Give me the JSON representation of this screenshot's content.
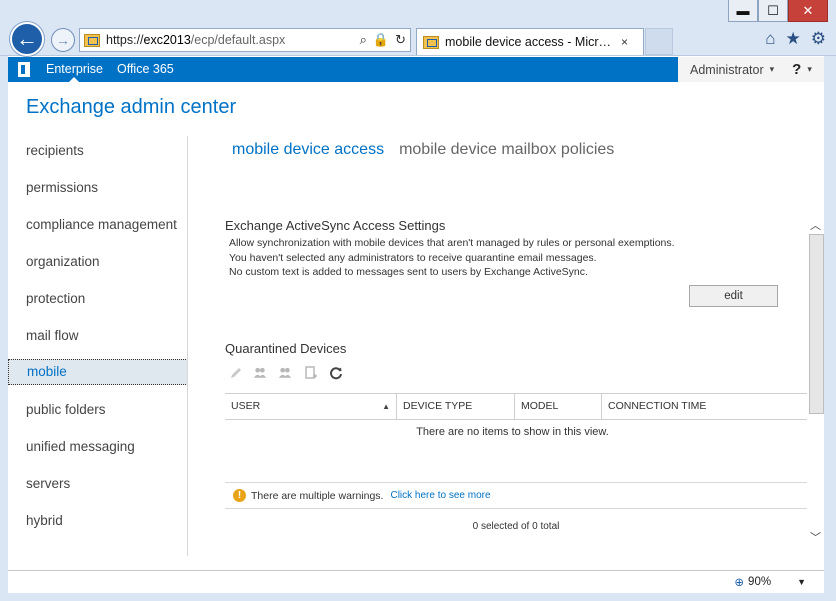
{
  "browser": {
    "address": {
      "prefix": "https://",
      "host": "exc2013",
      "path": "/ecp/default.aspx"
    },
    "tab_title": "mobile device access - Micr…",
    "tab_close": "×",
    "window_buttons": {
      "minimize": "▬",
      "maximize": "☐",
      "close": "✕"
    },
    "icons": {
      "home": "⌂",
      "favorites": "★",
      "settings": "⚙",
      "back": "←",
      "forward": "→",
      "search": "⌕",
      "lock": "🔒",
      "refresh": "↻"
    }
  },
  "topbar": {
    "enterprise": "Enterprise",
    "office365": "Office 365",
    "user": "Administrator",
    "help": "?",
    "caret": "▾"
  },
  "app_title": "Exchange admin center",
  "nav": {
    "items": [
      {
        "label": "recipients"
      },
      {
        "label": "permissions"
      },
      {
        "label": "compliance management"
      },
      {
        "label": "organization"
      },
      {
        "label": "protection"
      },
      {
        "label": "mail flow"
      },
      {
        "label": "mobile"
      },
      {
        "label": "public folders"
      },
      {
        "label": "unified messaging"
      },
      {
        "label": "servers"
      },
      {
        "label": "hybrid"
      }
    ]
  },
  "subtabs": {
    "active": "mobile device access",
    "other": "mobile device mailbox policies"
  },
  "activesync": {
    "title": "Exchange ActiveSync Access Settings",
    "line1": "Allow synchronization with mobile devices that aren't managed by rules or personal exemptions.",
    "line2": "You haven't selected any administrators to receive quarantine email messages.",
    "line3": "No custom text is added to messages sent to users by Exchange ActiveSync.",
    "edit_label": "edit"
  },
  "quarantine": {
    "title": "Quarantined Devices",
    "columns": {
      "user": "USER",
      "device_type": "DEVICE TYPE",
      "model": "MODEL",
      "connection_time": "CONNECTION TIME"
    },
    "sort_indicator": "▲",
    "empty_message": "There are no items to show in this view.",
    "warning_text": "There are multiple warnings.",
    "warning_link": "Click here to see more",
    "selection_count": "0 selected of 0 total"
  },
  "status": {
    "zoom": "90%"
  },
  "colors": {
    "accent": "#0072c6",
    "warning": "#e8a317"
  }
}
